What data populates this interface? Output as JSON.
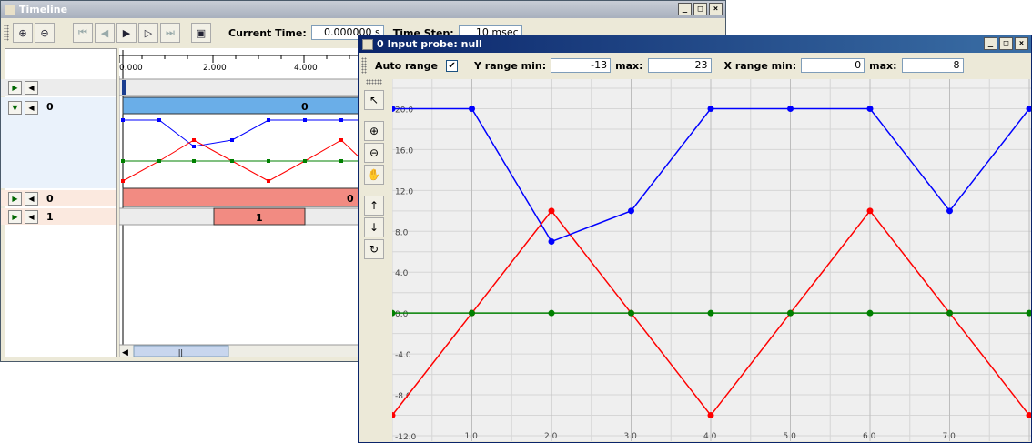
{
  "timeline": {
    "title": "Timeline",
    "current_time_label": "Current Time:",
    "current_time_value": "0.000000 s",
    "time_step_label": "Time Step:",
    "time_step_value": "10 msec",
    "ruler_ticks": [
      "0.000",
      "2.000",
      "4.000"
    ],
    "rows": [
      {
        "label": "0",
        "bar_label": "0"
      },
      {
        "label": "0",
        "bar_label": "0"
      },
      {
        "label": "1",
        "bar_label": "1"
      }
    ]
  },
  "probe": {
    "title": "0 Input probe: null",
    "auto_range_label": "Auto range",
    "auto_range_checked": "✔",
    "y_range_min_label": "Y range min:",
    "y_range_min_value": "-13",
    "y_max_label": "max:",
    "y_max_value": "23",
    "x_range_min_label": "X range min:",
    "x_range_min_value": "0",
    "x_max_label": "max:",
    "x_max_value": "8"
  },
  "chart_data": {
    "type": "line",
    "xlim": [
      0,
      8
    ],
    "ylim": [
      -12,
      22
    ],
    "y_ticks": [
      "20.0",
      "16.0",
      "12.0",
      "8.0",
      "4.0",
      "0.0",
      "-4.0",
      "-8.0",
      "-12.0"
    ],
    "x_ticks": [
      "1.0",
      "2.0",
      "3.0",
      "4.0",
      "5.0",
      "6.0",
      "7.0"
    ],
    "grid": true,
    "x": [
      0,
      1,
      2,
      3,
      4,
      5,
      6,
      7,
      8
    ],
    "series": [
      {
        "color": "#0000ff",
        "values": [
          20,
          20,
          7,
          10,
          20,
          20,
          20,
          10,
          20
        ]
      },
      {
        "color": "#ff0000",
        "values": [
          -10,
          0,
          10,
          0,
          -10,
          0,
          10,
          0,
          -10
        ]
      },
      {
        "color": "#008000",
        "values": [
          0,
          0,
          0,
          0,
          0,
          0,
          0,
          0,
          0
        ]
      }
    ]
  },
  "colors": {
    "blue_bar": "#6aaee8",
    "red_bar": "#f28b82",
    "title_active": "#0a246a"
  }
}
